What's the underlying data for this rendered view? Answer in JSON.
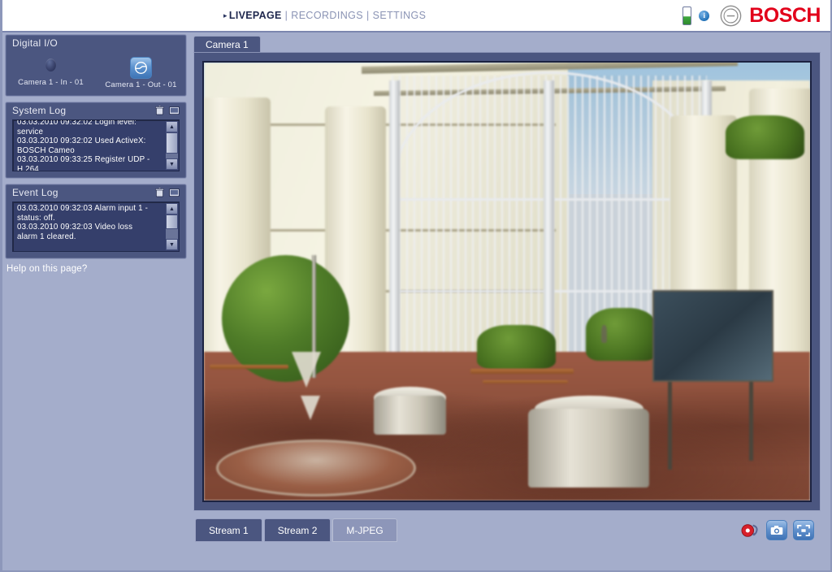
{
  "header": {
    "nav_arrow": "▸",
    "nav_items": [
      {
        "label": "LIVEPAGE",
        "active": true
      },
      {
        "label": "RECORDINGS",
        "active": false
      },
      {
        "label": "SETTINGS",
        "active": false
      }
    ],
    "separator": "|",
    "info_icon_glyph": "i",
    "brand_name": "BOSCH",
    "brand_color": "#e2001a",
    "stream_indicator_name": "stream-status-indicator"
  },
  "sidebar": {
    "digital_io": {
      "title": "Digital I/O",
      "inputs": [
        {
          "label": "Camera 1 - In - 01",
          "type": "led",
          "state": "off"
        }
      ],
      "outputs": [
        {
          "label": "Camera 1 - Out - 01",
          "type": "relay",
          "state": "idle"
        }
      ]
    },
    "system_log": {
      "title": "System Log",
      "entries": [
        "03.03.2010 09:32:02 Login level: service",
        "03.03.2010 09:32:02 Used ActiveX: BOSCH Cameo",
        "03.03.2010 09:33:25 Register UDP - H.264"
      ],
      "delete_icon": "trash-icon",
      "window_icon": "window-icon"
    },
    "event_log": {
      "title": "Event Log",
      "entries": [
        "03.03.2010 09:32:03 Alarm input 1 - status: off.",
        "03.03.2010 09:32:03 Video loss alarm 1 cleared."
      ],
      "delete_icon": "trash-icon",
      "window_icon": "window-icon"
    },
    "help_link": "Help on this page?"
  },
  "main": {
    "camera_tabs": [
      {
        "label": "Camera 1",
        "active": true
      }
    ],
    "stream_tabs": [
      {
        "label": "Stream 1",
        "active": false
      },
      {
        "label": "Stream 2",
        "active": false
      },
      {
        "label": "M-JPEG",
        "active": true
      }
    ],
    "view_controls": [
      {
        "name": "recording-status-icon",
        "label": "Recording"
      },
      {
        "name": "snapshot-button",
        "label": "Save snapshot"
      },
      {
        "name": "fullscreen-button",
        "label": "Full screen"
      }
    ]
  },
  "colors": {
    "page_background": "#a4adcb",
    "panel_background": "#4b5680",
    "panel_border": "#8d96b9",
    "log_background": "#353f6b",
    "accent_red": "#e2001a",
    "active_tab": "#8d96b9"
  }
}
